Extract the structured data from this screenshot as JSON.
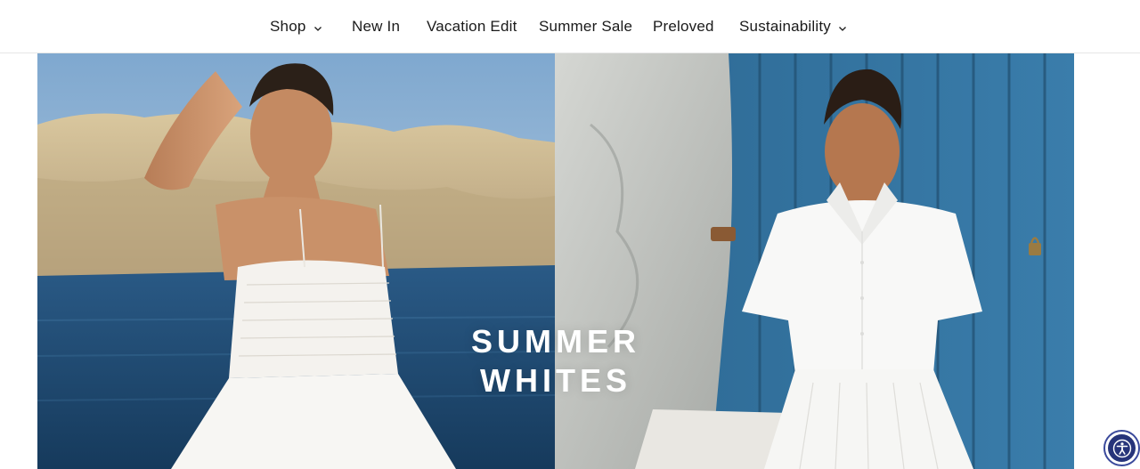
{
  "nav": {
    "items": [
      {
        "label": "Shop",
        "has_dropdown": true
      },
      {
        "label": "New In",
        "has_dropdown": false
      },
      {
        "label": "Vacation Edit",
        "has_dropdown": false
      },
      {
        "label": "Summer Sale",
        "has_dropdown": false
      },
      {
        "label": "Preloved",
        "has_dropdown": false
      },
      {
        "label": "Sustainability",
        "has_dropdown": true
      }
    ]
  },
  "hero": {
    "title_line1": "SUMMER",
    "title_line2": "WHITES"
  },
  "icons": {
    "dropdown": "chevron-down-icon",
    "accessibility": "accessibility-icon"
  },
  "colors": {
    "nav_text": "#1a1a1a",
    "hero_text": "#ffffff",
    "accessibility_button": "#27347a",
    "door_blue": "#2f6e9a",
    "sea": "#1f4f7a"
  }
}
